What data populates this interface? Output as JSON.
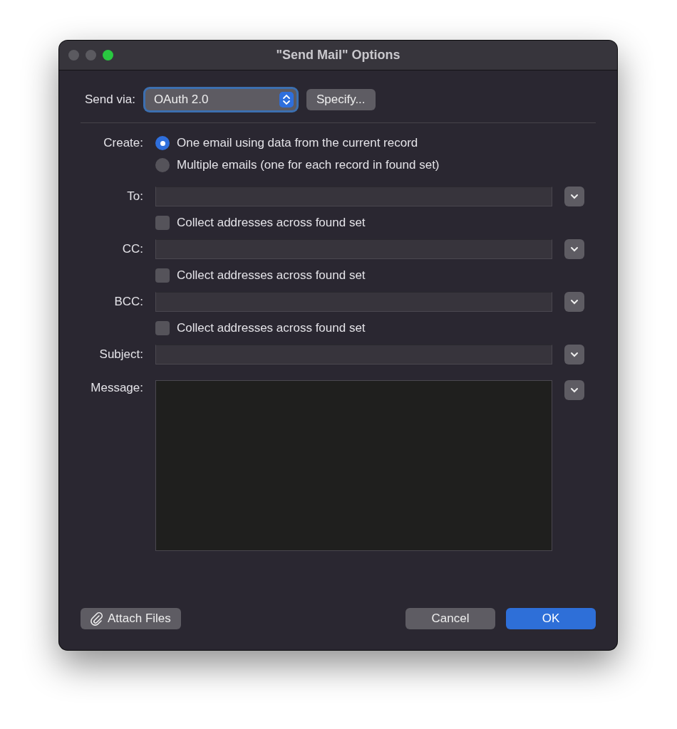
{
  "window": {
    "title": "\"Send Mail\" Options",
    "traffic_lights": [
      {
        "color": "#5b5a60"
      },
      {
        "color": "#5b5a60"
      },
      {
        "color": "#29c840"
      }
    ]
  },
  "send_via": {
    "label": "Send via:",
    "value": "OAuth 2.0",
    "button": "Specify..."
  },
  "create": {
    "label": "Create:",
    "options": [
      {
        "label": "One email using data from the current record",
        "selected": true
      },
      {
        "label": "Multiple emails (one for each record in found set)",
        "selected": false
      }
    ]
  },
  "fields": [
    {
      "label": "To:",
      "kind": "line",
      "collect": {
        "label": "Collect addresses across found set",
        "checked": false
      }
    },
    {
      "label": "CC:",
      "kind": "line",
      "collect": {
        "label": "Collect addresses across found set",
        "checked": false
      }
    },
    {
      "label": "BCC:",
      "kind": "line",
      "collect": {
        "label": "Collect addresses across found set",
        "checked": false
      }
    },
    {
      "label": "Subject:",
      "kind": "line"
    },
    {
      "label": "Message:",
      "kind": "area"
    }
  ],
  "buttons": {
    "attach": "Attach Files",
    "cancel": "Cancel",
    "ok": "OK"
  }
}
